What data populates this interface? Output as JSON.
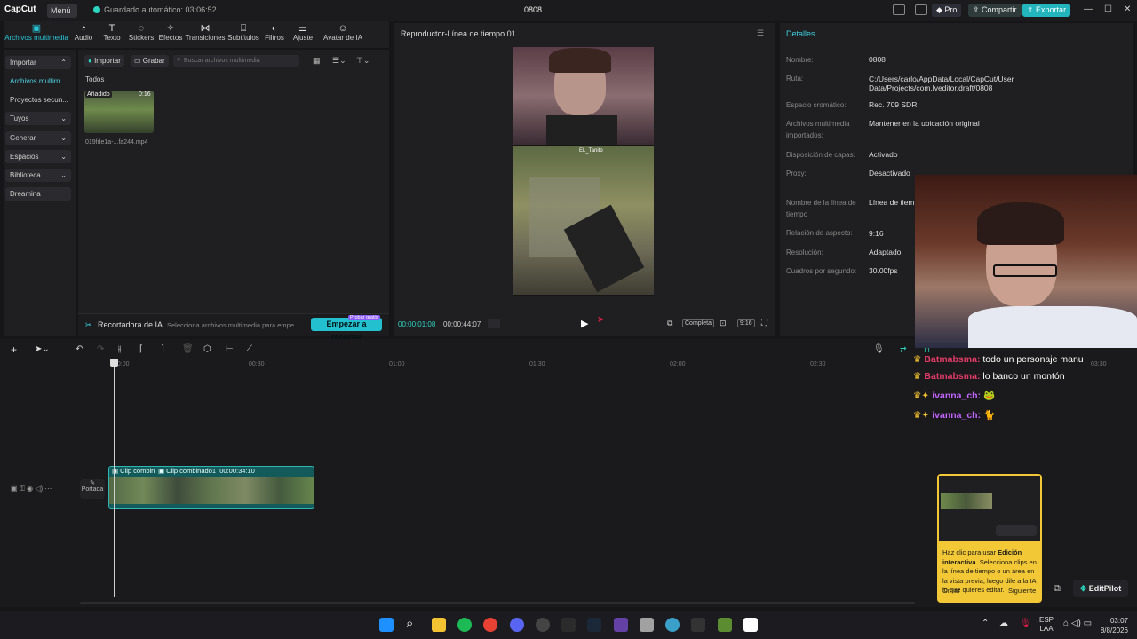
{
  "titlebar": {
    "app_name": "CapCut",
    "menu_label": "Menú",
    "autosave": "Guardado automático: 03:06:52",
    "project_title": "0808",
    "pro_label": "Pro",
    "share_label": "Compartir",
    "export_label": "Exportar"
  },
  "tools": [
    {
      "label": "Archivos multimedia",
      "icon": "media-icon"
    },
    {
      "label": "Audio",
      "icon": "audio-icon"
    },
    {
      "label": "Texto",
      "icon": "text-icon"
    },
    {
      "label": "Stickers",
      "icon": "sticker-icon"
    },
    {
      "label": "Efectos",
      "icon": "effects-icon"
    },
    {
      "label": "Transiciones",
      "icon": "transitions-icon"
    },
    {
      "label": "Subtítulos",
      "icon": "subtitles-icon"
    },
    {
      "label": "Filtros",
      "icon": "filters-icon"
    },
    {
      "label": "Ajuste",
      "icon": "adjust-icon"
    },
    {
      "label": "Avatar de IA",
      "icon": "ai-avatar-icon"
    }
  ],
  "leftnav": {
    "items": [
      "Importar",
      "Archivos multim...",
      "Proyectos secun...",
      "Tuyos",
      "Generar",
      "Espacios",
      "Biblioteca",
      "Dreamina"
    ]
  },
  "media": {
    "import_label": "Importar",
    "record_label": "Grabar",
    "search_placeholder": "Buscar archivos multimedia",
    "all_label": "Todos",
    "thumb_badge": "Añadido",
    "thumb_duration": "0:16",
    "thumb_filename": "019fde1a-...fa244.mp4"
  },
  "aibar": {
    "title": "Recortadora de IA",
    "hint": "Selecciona archivos multimedia para empe...",
    "start_label": "Empezar a recortar",
    "badge": "Probar gratis"
  },
  "player": {
    "title": "Reproductor-Línea de tiempo 01",
    "current_time": "00:00:01:08",
    "total_time": "00:00:44:07",
    "full_label": "Completa",
    "ratio_label": "9:16",
    "overlay_name": "EL_Tanito"
  },
  "details": {
    "title": "Detalles",
    "rows": [
      {
        "label": "Nombre:",
        "value": "0808"
      },
      {
        "label": "Ruta:",
        "value": "C:/Users/carlo/AppData/Local/CapCut/User Data/Projects/com.lveditor.draft/0808"
      },
      {
        "label": "Espacio cromático:",
        "value": "Rec. 709 SDR"
      },
      {
        "label": "Archivos multimedia importados:",
        "value": "Mantener en la ubicación original"
      },
      {
        "label": "Disposición de capas:",
        "value": "Activado"
      },
      {
        "label": "Proxy:",
        "value": "Desactivado"
      },
      {
        "label": "Nombre de la línea de tiempo",
        "value": "Línea de tiemp"
      },
      {
        "label": "Relación de aspecto:",
        "value": "9:16"
      },
      {
        "label": "Resolución:",
        "value": "Adaptado"
      },
      {
        "label": "Cuadros por segundo:",
        "value": "30.00fps"
      }
    ]
  },
  "timeline": {
    "ruler": [
      "00:00",
      "00:30",
      "01:00",
      "01:30",
      "02:00",
      "02:30",
      "03:30"
    ],
    "clip1_label": "Clip combin",
    "clip2_label": "Clip combinado1",
    "clip2_duration": "00:00:34:10",
    "cover_label": "Portada"
  },
  "chat": [
    {
      "user": "Batmabsma:",
      "text": "todo un personaje manu"
    },
    {
      "user": "Batmabsma:",
      "text": "lo banco un montón"
    },
    {
      "user": "ivanna_ch:",
      "text": "🐸"
    },
    {
      "user": "ivanna_ch:",
      "text": "🐈"
    }
  ],
  "popup": {
    "text_prefix": "Haz clic para usar ",
    "text_bold": "Edición interactiva",
    "text_rest": ". Selecciona clips en la línea de tiempo o un área en la vista previa; luego dile a la",
    "text_end": "IA lo que quieres editar.",
    "skip_label": "Omitir",
    "next_label": "Siguiente"
  },
  "editpilot_label": "EditPilot",
  "taskbar": {
    "lang1": "ESP",
    "lang2": "LAA",
    "time": "03:07",
    "date": "8/8/2026"
  }
}
